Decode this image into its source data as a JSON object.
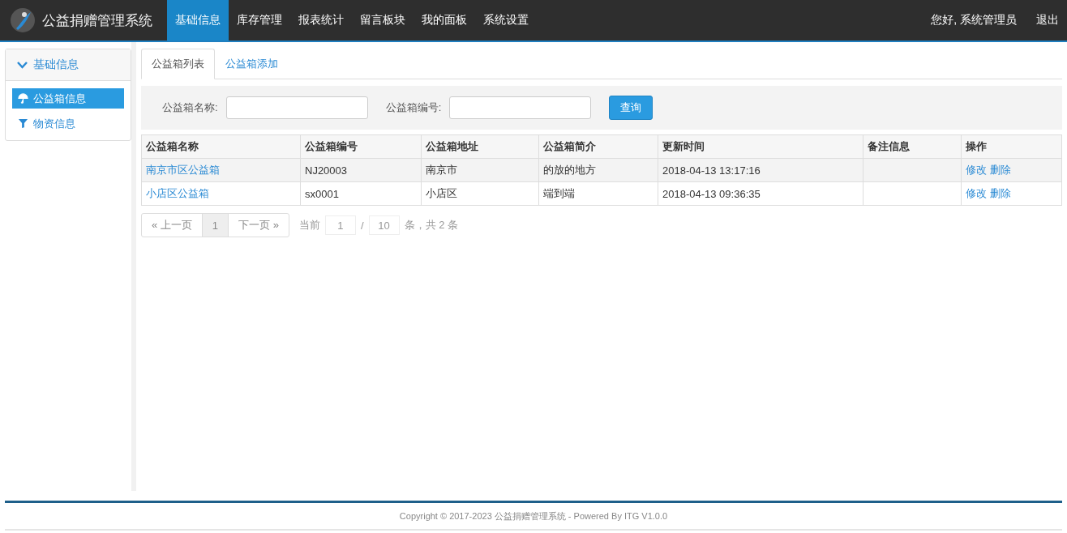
{
  "header": {
    "title": "公益捐赠管理系统",
    "nav": [
      {
        "label": "基础信息",
        "selected": true
      },
      {
        "label": "库存管理",
        "selected": false
      },
      {
        "label": "报表统计",
        "selected": false
      },
      {
        "label": "留言板块",
        "selected": false
      },
      {
        "label": "我的面板",
        "selected": false
      },
      {
        "label": "系统设置",
        "selected": false
      }
    ],
    "greeting": "您好, 系统管理员",
    "logout": "退出"
  },
  "sidebar": {
    "group": {
      "label": "基础信息",
      "expanded": true
    },
    "items": [
      {
        "label": "公益箱信息",
        "kind": "umbrella",
        "selected": true
      },
      {
        "label": "物资信息",
        "kind": "funnel",
        "selected": false
      }
    ]
  },
  "tabs": [
    {
      "label": "公益箱列表",
      "selected": true
    },
    {
      "label": "公益箱添加",
      "selected": false
    }
  ],
  "search": {
    "fields": [
      {
        "label": "公益箱名称:"
      },
      {
        "label": "公益箱编号:"
      }
    ],
    "button": "查询"
  },
  "table": {
    "columns": [
      "公益箱名称",
      "公益箱编号",
      "公益箱地址",
      "公益箱简介",
      "更新时间",
      "备注信息",
      "操作"
    ],
    "rows": [
      {
        "cells": [
          "南京市区公益箱",
          "NJ20003",
          "南京市",
          "的放的地方",
          "2018-04-13 13:17:16",
          ""
        ],
        "actions": [
          "修改",
          "删除"
        ]
      },
      {
        "cells": [
          "小店区公益箱",
          "sx0001",
          "小店区",
          "端到端",
          "2018-04-13 09:36:35",
          ""
        ],
        "actions": [
          "修改",
          "删除"
        ]
      }
    ]
  },
  "pagination": {
    "prev": "« 上一页",
    "pages": [
      {
        "label": "1",
        "selected": true
      }
    ],
    "next": "下一页 »",
    "current_label": "当前",
    "page_value": "1",
    "separator": "/",
    "page_size_value": "10",
    "total_text": "条，共 2 条"
  },
  "footer": "Copyright © 2017-2023 公益捐赠管理系统 - Powered By ITG V1.0.0"
}
